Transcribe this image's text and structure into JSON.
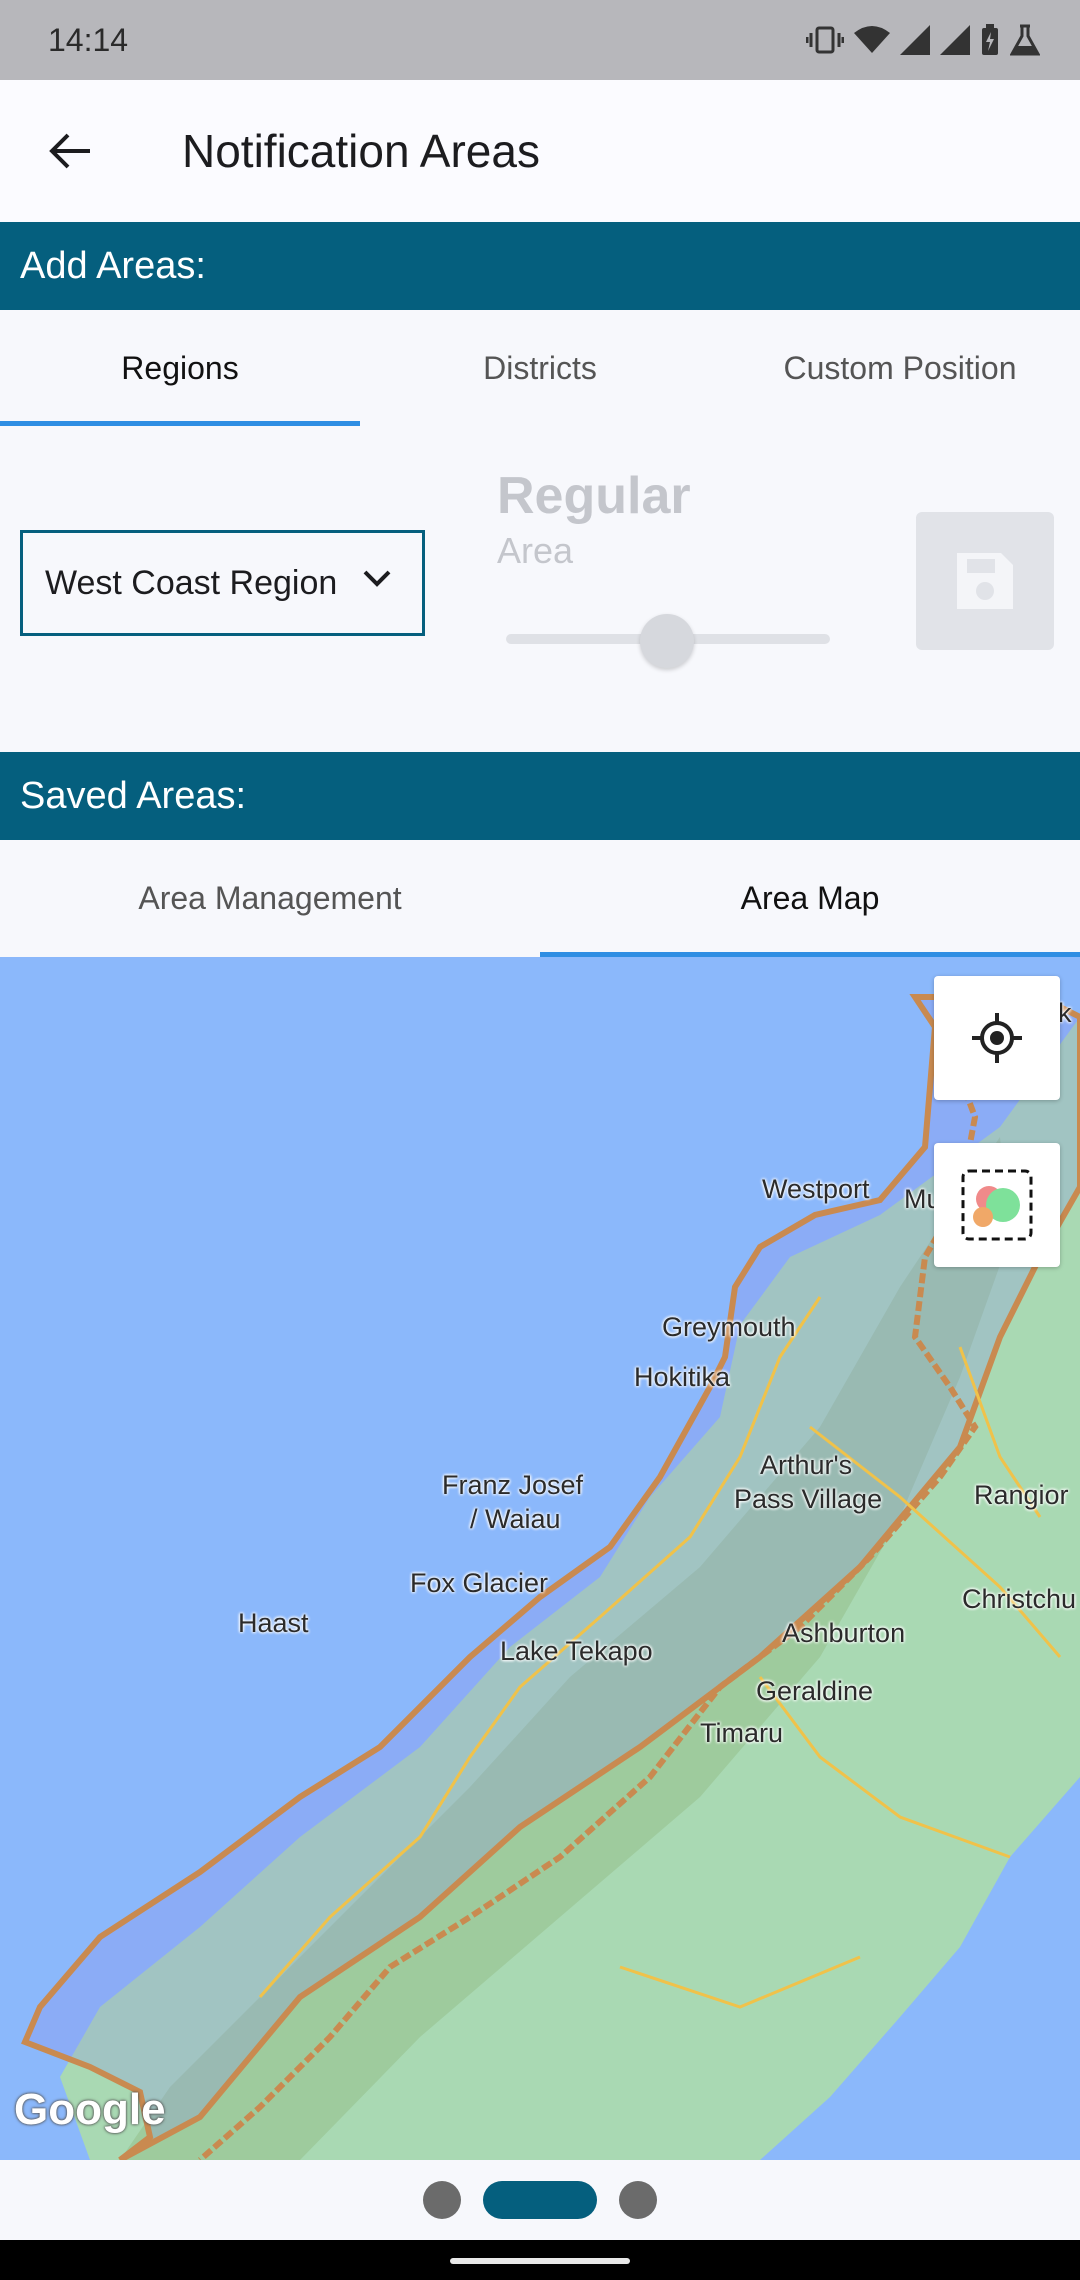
{
  "status_bar": {
    "time": "14:14"
  },
  "app_bar": {
    "title": "Notification Areas"
  },
  "add_section": {
    "title": "Add Areas:"
  },
  "add_tabs": [
    {
      "label": "Regions",
      "active": true
    },
    {
      "label": "Districts",
      "active": false
    },
    {
      "label": "Custom Position",
      "active": false
    }
  ],
  "controls": {
    "region_selected": "West Coast Region",
    "area_type_title": "Regular",
    "area_type_sub": "Area",
    "slider_level": 0.5
  },
  "saved_section": {
    "title": "Saved Areas:"
  },
  "saved_tabs": [
    {
      "label": "Area Management",
      "active": false
    },
    {
      "label": "Area Map",
      "active": true
    }
  ],
  "map": {
    "labels": {
      "westport": "Westport",
      "murchison": "Murchison",
      "greymouth": "Greymouth",
      "hokitika": "Hokitika",
      "arthurs_pass_1": "Arthur's",
      "arthurs_pass_2": "Pass Village",
      "rangiora": "Rangior",
      "franz_josef_1": "Franz Josef",
      "franz_josef_2": "/ Waiau",
      "fox_glacier": "Fox Glacier",
      "christchurch": "Christchu",
      "haast": "Haast",
      "ashburton": "Ashburton",
      "lake_tekapo": "Lake Tekapo",
      "geraldine": "Geraldine",
      "timaru": "Timaru",
      "edge_k": "k"
    },
    "attribution": "Google"
  },
  "pager": {
    "pages": 3,
    "active_index": 1
  },
  "colors": {
    "accent": "#055f7e",
    "tab_indicator": "#2f8ee3",
    "water": "#8bb8fb",
    "region_border": "#c98a50"
  }
}
